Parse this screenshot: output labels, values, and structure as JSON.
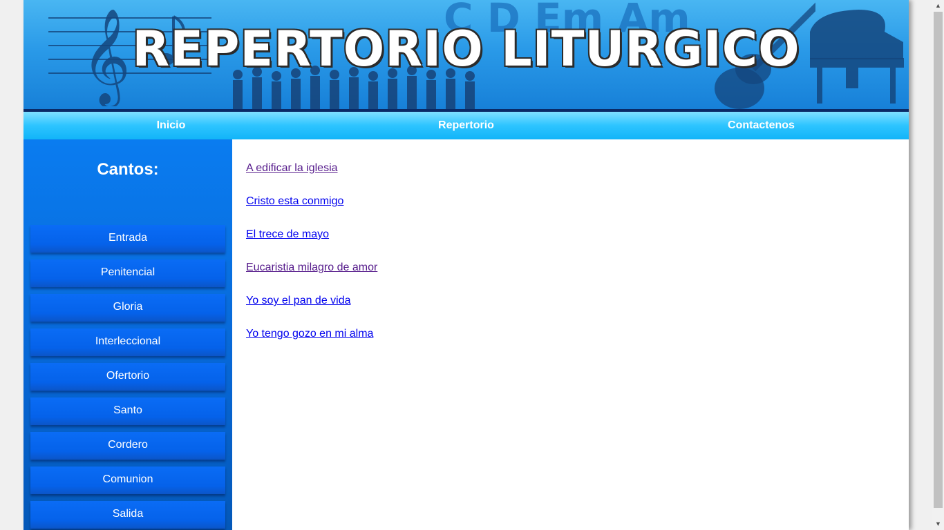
{
  "banner": {
    "title": "REPERTORIO LITURGICO",
    "chords": "C D Em Am"
  },
  "nav": {
    "items": [
      {
        "label": "Inicio"
      },
      {
        "label": "Repertorio"
      },
      {
        "label": "Contactenos"
      }
    ]
  },
  "sidebar": {
    "heading": "Cantos:",
    "items": [
      {
        "label": "Entrada"
      },
      {
        "label": "Penitencial"
      },
      {
        "label": "Gloria"
      },
      {
        "label": "Interleccional"
      },
      {
        "label": "Ofertorio"
      },
      {
        "label": "Santo"
      },
      {
        "label": "Cordero"
      },
      {
        "label": "Comunion"
      },
      {
        "label": "Salida"
      }
    ]
  },
  "songs": [
    {
      "title": "A edificar la iglesia",
      "visited": true
    },
    {
      "title": "Cristo esta conmigo",
      "visited": false
    },
    {
      "title": "El trece de mayo",
      "visited": false
    },
    {
      "title": "Eucaristia milagro de amor",
      "visited": true
    },
    {
      "title": "Yo soy el pan de vida",
      "visited": false
    },
    {
      "title": "Yo tengo gozo en mi alma",
      "visited": false
    }
  ],
  "colors": {
    "link": "#0000ee",
    "link_visited": "#551a8b",
    "sidebar": "#0766d4",
    "nav": "#2dc4ff"
  }
}
